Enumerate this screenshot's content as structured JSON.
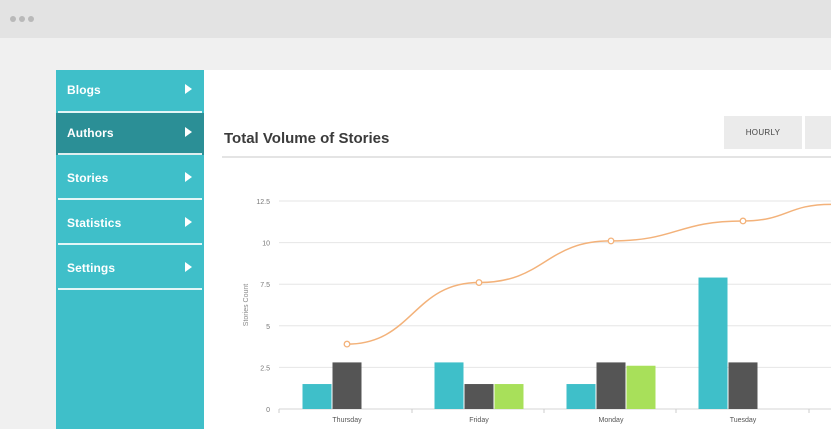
{
  "window": {
    "controls": [
      "dot",
      "dot",
      "dot"
    ]
  },
  "sidebar": {
    "items": [
      {
        "label": "Blogs",
        "active": false
      },
      {
        "label": "Authors",
        "active": true
      },
      {
        "label": "Stories",
        "active": false
      },
      {
        "label": "Statistics",
        "active": false
      },
      {
        "label": "Settings",
        "active": false
      }
    ]
  },
  "header": {
    "title": "Total Volume of Stories",
    "range_buttons": [
      {
        "label": "HOURLY"
      },
      {
        "label": ""
      }
    ]
  },
  "colors": {
    "sidebar": "#3fbfc9",
    "sidebar_active": "#2b8f96",
    "series_teal": "#3fbfc9",
    "series_dark": "#555555",
    "series_green": "#a8e05a",
    "line": "#f3b27a"
  },
  "chart_data": {
    "type": "bar",
    "categories": [
      "Thursday",
      "Friday",
      "Monday",
      "Tuesday"
    ],
    "ylabel": "Stories Count",
    "yticks": [
      "12.5",
      "10",
      "7.5",
      "5",
      "2.5",
      "0"
    ],
    "ylim": [
      0,
      12.5
    ],
    "grid": true,
    "series": [
      {
        "values": [
          1.5,
          2.8,
          1.5,
          7.9
        ]
      },
      {
        "values": [
          2.8,
          1.5,
          2.8,
          2.8
        ]
      },
      {
        "values": [
          null,
          1.5,
          2.6,
          null
        ]
      }
    ],
    "line": {
      "values": [
        3.9,
        7.6,
        10.1,
        11.3
      ],
      "trailing_value": 12.3
    }
  }
}
